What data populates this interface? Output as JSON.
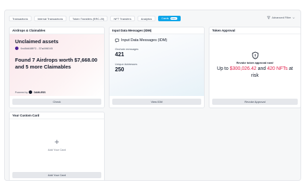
{
  "tabs": [
    {
      "label": "Transactions"
    },
    {
      "label": "Internal Transactions"
    },
    {
      "label": "Token Transfers (ERC-20)"
    },
    {
      "label": "NFT Transfers"
    },
    {
      "label": "Analytics"
    },
    {
      "label": "Cards",
      "badge": "New"
    }
  ],
  "advanced_filter": "Advanced Filter",
  "airdrops": {
    "header": "Airdrops & Claimables",
    "title": "Unclaimed assets",
    "address": "0xd8dA6BF2...37aA96045",
    "found_line1": "Found 7 Airdrops worth $7,668.00",
    "found_line2": "and 5 more Claimables",
    "powered_by": "Powered by",
    "brand": "DAMLESS",
    "button": "Check"
  },
  "idm": {
    "header": "Input Data Messages (IDM)",
    "title": "Input Data Messages (IDM)",
    "onchain_label": "Onchain messages",
    "onchain_value": "421",
    "unique_label": "Unique Addresses",
    "unique_value": "250",
    "button": "View IDM"
  },
  "approval": {
    "header": "Token Approval",
    "prompt": "Revoke token approval now!",
    "risk_prefix": "Up to ",
    "risk_amount": "$300,026.42",
    "risk_mid": " and ",
    "risk_nfts": "420 NFTs",
    "risk_suffix": " at risk",
    "button": "Revoke Approval"
  },
  "custom": {
    "header": "Your Custom Card",
    "add_label": "Add Your Card",
    "button": "Add Your Card"
  },
  "colors": {
    "accent": "#0ea5e9",
    "risk_red": "#e11d48"
  }
}
